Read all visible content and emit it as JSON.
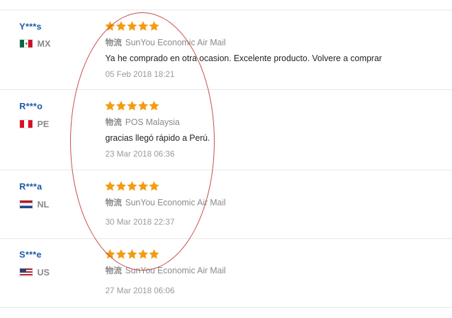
{
  "shipping_label": "物流",
  "colors": {
    "star": "#f39c12",
    "username": "#1a5aa8",
    "annotation": "#c64a4a"
  },
  "reviews": [
    {
      "user": "Y***s",
      "country": "MX",
      "flag_icon": "mexico-flag-icon",
      "stars": 5,
      "shipping": "SunYou Economic Air Mail",
      "feedback": "Ya he comprado en otra ocasion. Excelente producto. Volvere a comprar",
      "date": "05 Feb 2018 18:21"
    },
    {
      "user": "R***o",
      "country": "PE",
      "flag_icon": "peru-flag-icon",
      "stars": 5,
      "shipping": "POS Malaysia",
      "feedback": "gracias llegó rápido a Perú.",
      "date": "23 Mar 2018 06:36"
    },
    {
      "user": "R***a",
      "country": "NL",
      "flag_icon": "netherlands-flag-icon",
      "stars": 5,
      "shipping": "SunYou Economic Air Mail",
      "feedback": "",
      "date": "30 Mar 2018 22:37"
    },
    {
      "user": "S***e",
      "country": "US",
      "flag_icon": "usa-flag-icon",
      "stars": 5,
      "shipping": "SunYou Economic Air Mail",
      "feedback": "",
      "date": "27 Mar 2018 06:06"
    }
  ]
}
